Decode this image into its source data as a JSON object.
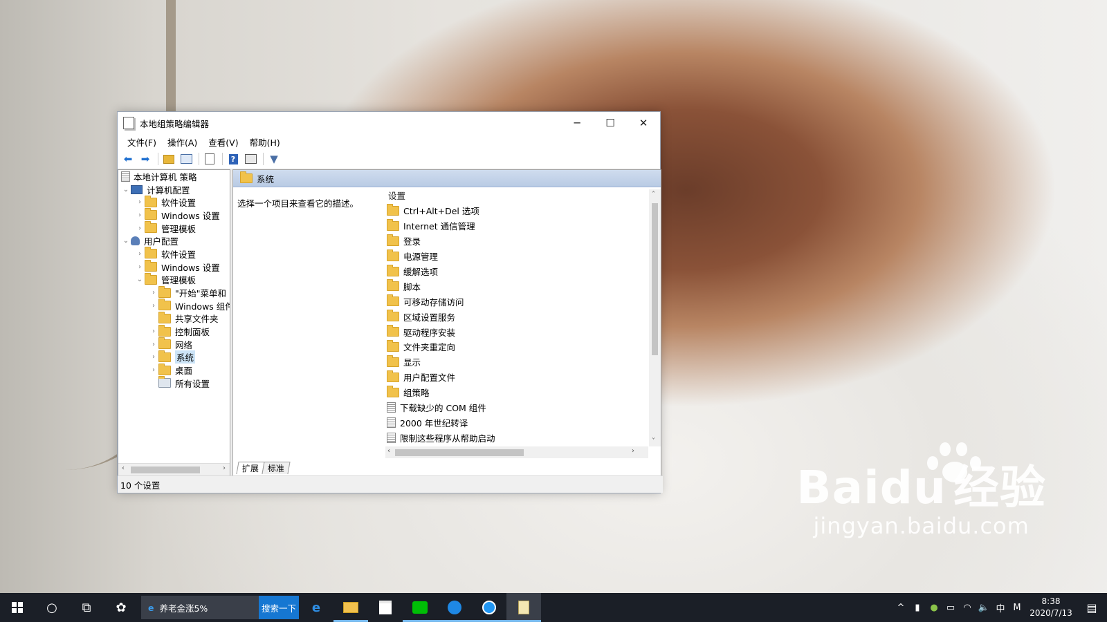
{
  "window": {
    "title": "本地组策略编辑器",
    "controls": {
      "minimize": "─",
      "maximize": "☐",
      "close": "✕"
    }
  },
  "menu": [
    "文件(F)",
    "操作(A)",
    "查看(V)",
    "帮助(H)"
  ],
  "toolbar_icons": [
    "back-arrow-icon",
    "forward-arrow-icon",
    "up-folder-icon",
    "show-tree-icon",
    "export-list-icon",
    "help-icon",
    "properties-icon",
    "filter-icon"
  ],
  "tree": {
    "root": "本地计算机 策略",
    "computer_config": "计算机配置",
    "cc_software": "软件设置",
    "cc_windows": "Windows 设置",
    "cc_admin": "管理模板",
    "user_config": "用户配置",
    "uc_software": "软件设置",
    "uc_windows": "Windows 设置",
    "uc_admin": "管理模板",
    "start_menu": "\"开始\"菜单和",
    "win_components": "Windows 组件",
    "shared_folders": "共享文件夹",
    "control_panel": "控制面板",
    "network": "网络",
    "system": "系统",
    "desktop": "桌面",
    "all_settings": "所有设置"
  },
  "right_pane": {
    "header": "系统",
    "description": "选择一个项目来查看它的描述。",
    "column": "设置",
    "items": [
      {
        "label": "Ctrl+Alt+Del 选项",
        "kind": "folder"
      },
      {
        "label": "Internet 通信管理",
        "kind": "folder"
      },
      {
        "label": "登录",
        "kind": "folder"
      },
      {
        "label": "电源管理",
        "kind": "folder"
      },
      {
        "label": "缓解选项",
        "kind": "folder"
      },
      {
        "label": "脚本",
        "kind": "folder"
      },
      {
        "label": "可移动存储访问",
        "kind": "folder"
      },
      {
        "label": "区域设置服务",
        "kind": "folder"
      },
      {
        "label": "驱动程序安装",
        "kind": "folder"
      },
      {
        "label": "文件夹重定向",
        "kind": "folder"
      },
      {
        "label": "显示",
        "kind": "folder"
      },
      {
        "label": "用户配置文件",
        "kind": "folder"
      },
      {
        "label": "组策略",
        "kind": "folder"
      },
      {
        "label": "下载缺少的 COM 组件",
        "kind": "policy"
      },
      {
        "label": "2000 年世纪转译",
        "kind": "policy"
      },
      {
        "label": "限制这些程序从帮助启动",
        "kind": "policy"
      }
    ],
    "tabs": [
      "扩展",
      "标准"
    ]
  },
  "status": "10 个设置",
  "taskbar": {
    "search_text": "养老金涨5%",
    "search_button": "搜索一下",
    "time": "8:38",
    "date": "2020/7/13",
    "ime": "中",
    "ime_mode": "M"
  },
  "watermark": {
    "logo_latin": "Bai",
    "logo_du": "du",
    "logo_cn": "经验",
    "url": "jingyan.baidu.com"
  }
}
